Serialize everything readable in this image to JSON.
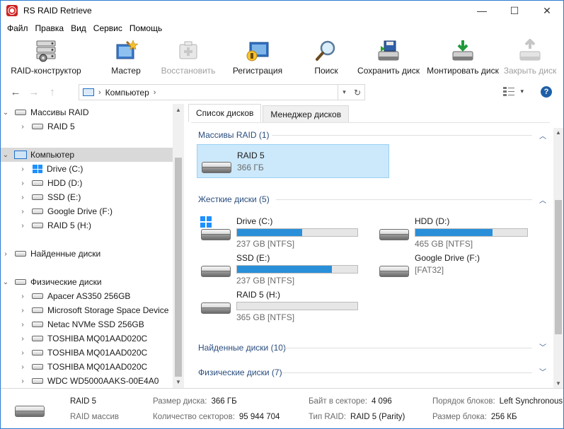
{
  "window": {
    "title": "RS RAID Retrieve",
    "min": "—",
    "max": "☐",
    "close": "✕"
  },
  "menu": [
    "Файл",
    "Правка",
    "Вид",
    "Сервис",
    "Помощь"
  ],
  "toolbar": [
    {
      "label": "RAID-конструктор",
      "icon": "raid-constructor-icon",
      "enabled": true
    },
    {
      "label": "Мастер",
      "icon": "wizard-icon",
      "enabled": true
    },
    {
      "label": "Восстановить",
      "icon": "recover-icon",
      "enabled": false
    },
    {
      "label": "Регистрация",
      "icon": "registration-icon",
      "enabled": true
    },
    {
      "label": "Поиск",
      "icon": "search-icon",
      "enabled": true
    },
    {
      "label": "Сохранить диск",
      "icon": "save-disk-icon",
      "enabled": true
    },
    {
      "label": "Монтировать диск",
      "icon": "mount-disk-icon",
      "enabled": true
    },
    {
      "label": "Закрыть диск",
      "icon": "close-disk-icon",
      "enabled": false
    }
  ],
  "nav": {
    "back": "←",
    "forward": "→",
    "up": "↑",
    "path": "Компьютер",
    "path_sep": "›",
    "path_sep_end": "›",
    "dropdown": "▾",
    "refresh": "↻",
    "view": "▾",
    "help": "?"
  },
  "tree": {
    "raid_group": "Массивы RAID",
    "raid_items": [
      "RAID 5"
    ],
    "computer": "Компьютер",
    "computer_items": [
      "Drive (C:)",
      "HDD (D:)",
      "SSD (E:)",
      "Google Drive (F:)",
      "RAID 5 (H:)"
    ],
    "found": "Найденные диски",
    "physical": "Физические диски",
    "physical_items": [
      "Apacer AS350 256GB",
      "Microsoft Storage Space Device",
      "Netac NVMe SSD 256GB",
      "TOSHIBA MQ01AAD020C",
      "TOSHIBA MQ01AAD020C",
      "TOSHIBA MQ01AAD020C",
      "WDC WD5000AAKS-00E4A0"
    ]
  },
  "tabs": [
    "Список дисков",
    "Менеджер дисков"
  ],
  "groups": {
    "raid": "Массивы RAID (1)",
    "hard": "Жесткие диски (5)",
    "found": "Найденные диски (10)",
    "physical": "Физические диски (7)"
  },
  "raid_card": {
    "name": "RAID 5",
    "size": "366 ГБ"
  },
  "disks": [
    {
      "name": "Drive (C:)",
      "info": "237 GB [NTFS]",
      "used": 0.54,
      "windows": true
    },
    {
      "name": "HDD (D:)",
      "info": "465 GB [NTFS]",
      "used": 0.69,
      "windows": false
    },
    {
      "name": "SSD (E:)",
      "info": "237 GB [NTFS]",
      "used": 0.79,
      "windows": false
    },
    {
      "name": "Google Drive (F:)",
      "info": "[FAT32]",
      "used": null,
      "windows": false
    },
    {
      "name": "RAID 5 (H:)",
      "info": "365 GB [NTFS]",
      "used": 0.0,
      "windows": false
    }
  ],
  "status": {
    "name": "RAID 5",
    "type": "RAID массив",
    "size_label": "Размер диска:",
    "size_value": "366 ГБ",
    "sectors_label": "Количество секторов:",
    "sectors_value": "95 944 704",
    "bps_label": "Байт в секторе:",
    "bps_value": "4 096",
    "raid_type_label": "Тип RAID:",
    "raid_type_value": "RAID 5 (Parity)",
    "order_label": "Порядок блоков:",
    "order_value": "Left Synchronous",
    "block_label": "Размер блока:",
    "block_value": "256 КБ"
  }
}
